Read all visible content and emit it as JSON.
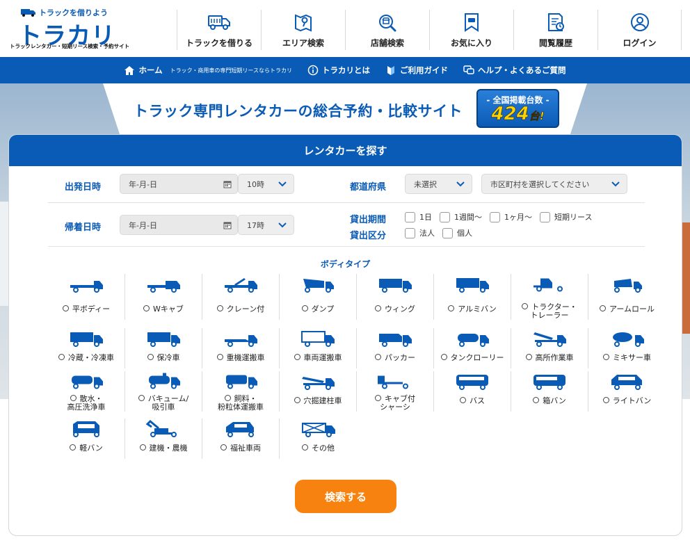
{
  "header": {
    "logo_top": "トラックを借りよう",
    "logo_main": "トラカリ",
    "logo_sub": "トラックレンタカー・短期リース検索・予約サイト",
    "nav": [
      {
        "label": "トラックを借りる",
        "icon": "truck-icon"
      },
      {
        "label": "エリア検索",
        "icon": "map-icon"
      },
      {
        "label": "店舗検索",
        "icon": "store-search-icon"
      },
      {
        "label": "お気に入り",
        "icon": "bookmark-icon"
      },
      {
        "label": "閲覧履歴",
        "icon": "history-icon"
      },
      {
        "label": "ログイン",
        "icon": "user-icon"
      }
    ]
  },
  "bluebar": {
    "home": "ホーム",
    "home_tag": "トラック・商用車の専門短期リースならトラカリ",
    "about": "トラカリとは",
    "guide": "ご利用ガイド",
    "help": "ヘルプ・よくあるご質問"
  },
  "hero": {
    "title": "トラック専門レンタカーの総合予約・比較サイト",
    "count_label": "- 全国掲載台数 -",
    "count_value": "424",
    "count_unit": "台!"
  },
  "search": {
    "heading": "レンタカーを探す",
    "depart_label": "出発日時",
    "depart_date": "年-月-日",
    "depart_time": "10時",
    "return_label": "帰着日時",
    "return_date": "年-月-日",
    "return_time": "17時",
    "pref_label": "都道府県",
    "pref_value": "未選択",
    "city_value": "市区町村を選択してください",
    "period_label": "貸出期間",
    "periods": [
      "1日",
      "1週間〜",
      "1ヶ月〜",
      "短期リース"
    ],
    "class_label": "貸出区分",
    "classes": [
      "法人",
      "個人"
    ],
    "body_title": "ボディタイプ",
    "button": "検索する"
  },
  "body_types": [
    "平ボディー",
    "Wキャブ",
    "クレーン付",
    "ダンプ",
    "ウィング",
    "アルミバン",
    "トラクター・\nトレーラー",
    "アームロール",
    "冷蔵・冷凍車",
    "保冷車",
    "重機運搬車",
    "車両運搬車",
    "パッカー",
    "タンクローリー",
    "高所作業車",
    "ミキサー車",
    "散水・\n高圧洗浄車",
    "バキューム/\n吸引車",
    "飼料・\n粉粒体運搬車",
    "穴掘建柱車",
    "キャブ付\nシャーシ",
    "バス",
    "箱バン",
    "ライトバン",
    "軽バン",
    "建機・農機",
    "福祉車両",
    "その他"
  ],
  "colors": {
    "brand": "#0a5bb5",
    "accent": "#f7820f",
    "badge_number": "#ffd400"
  }
}
